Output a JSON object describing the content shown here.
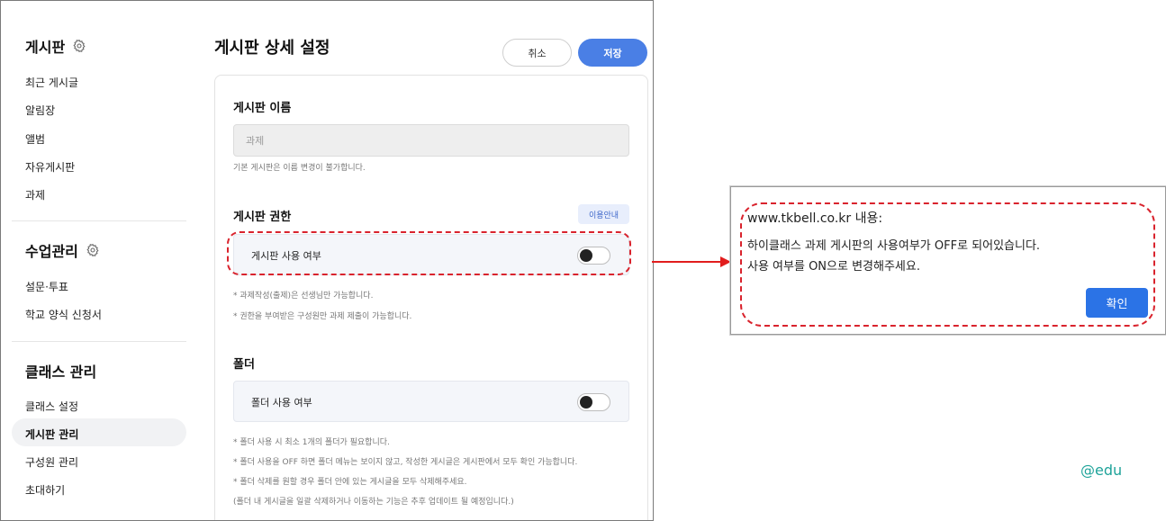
{
  "sidebar": {
    "board_title": "게시판",
    "board_items": [
      "최근 게시글",
      "알림장",
      "앨범",
      "자유게시판",
      "과제"
    ],
    "class_mgmt_title": "수업관리",
    "class_mgmt_items": [
      "설문·투표",
      "학교 양식 신청서"
    ],
    "class_admin_title": "클래스 관리",
    "class_admin_items": [
      "클래스 설정",
      "게시판 관리",
      "구성원 관리",
      "초대하기"
    ],
    "active_item": "게시판 관리"
  },
  "main": {
    "page_title": "게시판 상세 설정",
    "cancel_label": "취소",
    "save_label": "저장",
    "name_section_title": "게시판 이름",
    "name_value": "과제",
    "name_hint": "기본 게시판은 이름 변경이 불가합니다.",
    "permission_title": "게시판 권한",
    "guide_label": "이용안내",
    "board_use_label": "게시판 사용 여부",
    "board_use_on": false,
    "permission_notes": [
      "* 과제작성(출제)은 선생님만 가능합니다.",
      "* 권한을 부여받은 구성원만 과제 제출이 가능합니다."
    ],
    "folder_title": "폴더",
    "folder_use_label": "폴더 사용 여부",
    "folder_use_on": false,
    "folder_notes": [
      "* 폴더 사용 시 최소 1개의 폴더가 필요합니다.",
      "* 폴더 사용을 OFF 하면 폴더 메뉴는 보이지 않고, 작성한 게시글은 게시판에서 모두 확인 가능합니다.",
      "* 폴더 삭제를 원할 경우 폴더 안에 있는 게시글을 모두 삭제해주세요.",
      "(폴더 내 게시글을 일괄 삭제하거나 이동하는 기능은 추후 업데이트 될 예정입니다.)"
    ]
  },
  "dialog": {
    "title": "www.tkbell.co.kr 내용:",
    "message_line1": "하이클래스 과제 게시판의 사용여부가 OFF로 되어있습니다.",
    "message_line2": "사용 여부를 ON으로 변경해주세요.",
    "ok_label": "확인"
  },
  "watermark": "@edu",
  "colors": {
    "accent": "#4a7fe5",
    "dialog_button": "#2b73e6",
    "highlight": "#d9232d",
    "watermark": "#1fa39a"
  }
}
